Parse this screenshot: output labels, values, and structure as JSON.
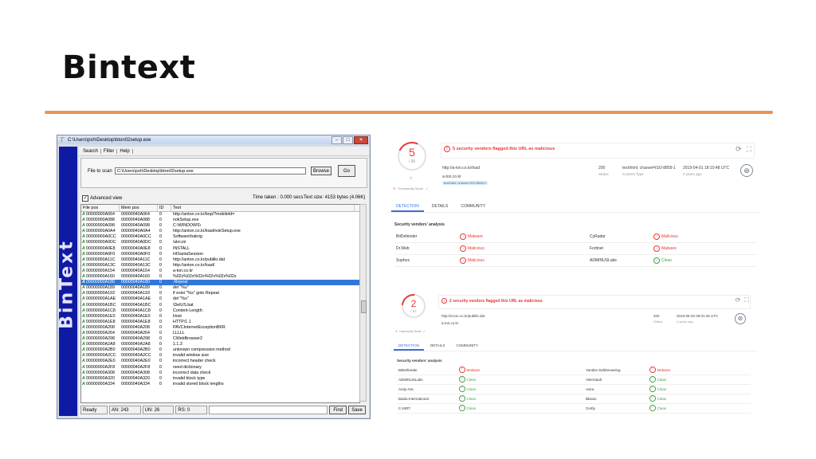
{
  "slide": {
    "title": "Bintext"
  },
  "bintext": {
    "window_title": "C:\\Users\\psh\\Desktop\\bton02setup.exe",
    "sidebar_text": "BinText",
    "menu": [
      "Search",
      "Filter",
      "Help"
    ],
    "file_label": "File to scan",
    "file_path": "C:\\Users\\psh\\Desktop\\bton02setup.exe",
    "browse_label": "Browse",
    "go_label": "Go",
    "advanced_view_label": "Advanced view",
    "time_taken": "Time taken : 0.000 secs",
    "text_size": "Text size: 4153 bytes (4.06K)",
    "columns": [
      "File pos",
      "Mem pos",
      "ID",
      "Text"
    ],
    "rows": [
      {
        "flag": "A",
        "file": "00000000A064",
        "mem": "00000040A064",
        "id": "0",
        "text": "http://anton.co.kr/bop/?mobileId="
      },
      {
        "flag": "A",
        "file": "00000000A088",
        "mem": "00000040A088",
        "id": "0",
        "text": "nokSetup.exe"
      },
      {
        "flag": "A",
        "file": "00000000A098",
        "mem": "00000040A098",
        "id": "0",
        "text": "C:\\WINDOWS\\"
      },
      {
        "flag": "A",
        "file": "00000000A0A4",
        "mem": "00000040A0A4",
        "id": "0",
        "text": "http://anton.co.kr/load/nokSetup.exe"
      },
      {
        "flag": "A",
        "file": "00000000A0CC",
        "mem": "00000040A0CC",
        "id": "0",
        "text": "Software\\hakrig"
      },
      {
        "flag": "A",
        "file": "00000000A0DC",
        "mem": "00000040A0DC",
        "id": "0",
        "text": "\\skn.ini"
      },
      {
        "flag": "A",
        "file": "00000000A0E8",
        "mem": "00000040A0E8",
        "id": "0",
        "text": "INSTALL"
      },
      {
        "flag": "A",
        "file": "00000000A0F0",
        "mem": "00000040A0F0",
        "id": "0",
        "text": "HISantaSession"
      },
      {
        "flag": "A",
        "file": "00000000A11C",
        "mem": "00000040A11C",
        "id": "0",
        "text": "http://anton.co.kr/publikr.dat"
      },
      {
        "flag": "A",
        "file": "00000000A13C",
        "mem": "00000040A13C",
        "id": "0",
        "text": "http://anton.co.kr/load/"
      },
      {
        "flag": "A",
        "file": "00000000A154",
        "mem": "00000040A154",
        "id": "0",
        "text": "a-ton.co.kr"
      },
      {
        "flag": "A",
        "file": "00000000A160",
        "mem": "00000040A160",
        "id": "0",
        "text": "%02x%02x%02x%02x%02x%02x"
      },
      {
        "flag": "A",
        "file": "00000000A180",
        "mem": "00000040A180",
        "id": "0",
        "text": ":Repeat",
        "selected": true
      },
      {
        "flag": "A",
        "file": "00000000A189",
        "mem": "00000040A189",
        "id": "0",
        "text": "del \"%s\""
      },
      {
        "flag": "A",
        "file": "00000000A193",
        "mem": "00000040A193",
        "id": "0",
        "text": "if exist \"%s\" goto Repeat"
      },
      {
        "flag": "A",
        "file": "00000000A1AE",
        "mem": "00000040A1AE",
        "id": "0",
        "text": "del \"%s\""
      },
      {
        "flag": "A",
        "file": "00000000A1BC",
        "mem": "00000040A1BC",
        "id": "0",
        "text": "\\DelUS.bat"
      },
      {
        "flag": "A",
        "file": "00000000A1C8",
        "mem": "00000040A1C8",
        "id": "0",
        "text": "Content-Length:"
      },
      {
        "flag": "A",
        "file": "00000000A1E0",
        "mem": "00000040A1E0",
        "id": "0",
        "text": "Host"
      },
      {
        "flag": "A",
        "file": "00000000A1E8",
        "mem": "00000040A1E8",
        "id": "0",
        "text": "HTTP/1.1"
      },
      {
        "flag": "A",
        "file": "00000000A208",
        "mem": "00000040A208",
        "id": "0",
        "text": "PAVCInternetExceptionBKR"
      },
      {
        "flag": "A",
        "file": "00000000A264",
        "mem": "00000040A264",
        "id": "0",
        "text": "LLLLL"
      },
      {
        "flag": "A",
        "file": "00000000A298",
        "mem": "00000040A298",
        "id": "0",
        "text": "CWebBrowser2"
      },
      {
        "flag": "A",
        "file": "00000000A2A8",
        "mem": "00000040A2A8",
        "id": "0",
        "text": "1.1.3"
      },
      {
        "flag": "A",
        "file": "00000000A2B0",
        "mem": "00000040A2B0",
        "id": "0",
        "text": "unknown compression method"
      },
      {
        "flag": "A",
        "file": "00000000A2CC",
        "mem": "00000040A2CC",
        "id": "0",
        "text": "invalid window size"
      },
      {
        "flag": "A",
        "file": "00000000A2E0",
        "mem": "00000040A2E0",
        "id": "0",
        "text": "incorrect header check"
      },
      {
        "flag": "A",
        "file": "00000000A2F8",
        "mem": "00000040A2F8",
        "id": "0",
        "text": "need dictionary"
      },
      {
        "flag": "A",
        "file": "00000000A308",
        "mem": "00000040A308",
        "id": "0",
        "text": "incorrect data check"
      },
      {
        "flag": "A",
        "file": "00000000A320",
        "mem": "00000040A320",
        "id": "0",
        "text": "invalid block type"
      },
      {
        "flag": "A",
        "file": "00000000A334",
        "mem": "00000040A334",
        "id": "0",
        "text": "invalid stored block lengths"
      }
    ],
    "status": {
      "ready": "Ready",
      "an": "AN: 243",
      "un": "UN: 26",
      "rs": "RS: 0",
      "find_label": "Find",
      "save_label": "Save"
    }
  },
  "vt1": {
    "score": "5",
    "score_total": "/ 66",
    "alert": "5 security vendors flagged this URL as malicious",
    "url": "http://a-ton.co.kr/load",
    "host": "a-ton.co.kr",
    "tag": "text/html; charset=ISO-8859-1",
    "status_code": "200",
    "status_label": "Status",
    "content_type": "text/html; charset=ISO-8859-1",
    "content_type_label": "Content Type",
    "date": "2019-04-01 18:10:48 UTC",
    "ago": "2 years ago",
    "community_label": "Community Score",
    "community_value": "?",
    "tabs": [
      "DETECTION",
      "DETAILS",
      "COMMUNITY"
    ],
    "section": "Security vendors' analysis",
    "rows": [
      {
        "v1": "BitDefender",
        "r1": "Malware",
        "s1": "mal",
        "v2": "CyRadar",
        "r2": "Malicious",
        "s2": "mal"
      },
      {
        "v1": "Dr.Web",
        "r1": "Malicious",
        "s1": "mal",
        "v2": "Fortinet",
        "r2": "Malware",
        "s2": "mal"
      },
      {
        "v1": "Sophos",
        "r1": "Malicious",
        "s1": "mal",
        "v2": "ADMINUSLabs",
        "r2": "Clean",
        "s2": "clean"
      }
    ]
  },
  "vt2": {
    "score": "2",
    "score_total": "/ 67",
    "alert": "2 security vendors flagged this URL as malicious",
    "url": "http://a-ton.co.kr/publikr.dat",
    "host": "a-ton.co.kr",
    "status_code": "200",
    "status_label": "Status",
    "date": "2016-06-20 06:01:45 UTC",
    "ago": "4 years ago",
    "community_label": "Community Score",
    "tabs": [
      "DETECTION",
      "DETAILS",
      "COMMUNITY"
    ],
    "section": "Security vendors' analysis",
    "rows": [
      {
        "v1": "BitDefender",
        "r1": "Malware",
        "s1": "mal",
        "v2": "Yandex Safebrowsing",
        "r2": "Malware",
        "s2": "mal"
      },
      {
        "v1": "ADMINUSLabs",
        "r1": "Clean",
        "s1": "clean",
        "v2": "AlienVault",
        "r2": "Clean",
        "s2": "clean"
      },
      {
        "v1": "Antiy-AVL",
        "r1": "Clean",
        "s1": "clean",
        "v2": "Avira",
        "r2": "Clean",
        "s2": "clean"
      },
      {
        "v1": "Baidu-International",
        "r1": "Clean",
        "s1": "clean",
        "v2": "Bkavio",
        "r2": "Clean",
        "s2": "clean"
      },
      {
        "v1": "C-SIRT",
        "r1": "Clean",
        "s1": "clean",
        "v2": "Certly",
        "r2": "Clean",
        "s2": "clean"
      }
    ]
  },
  "colors": {
    "accent_rule": "#e99555",
    "malicious": "#e53935",
    "clean": "#43a047",
    "bintext_sidebar": "#0e1aa4",
    "selection": "#3276d8",
    "vt_tab_active": "#3b6fd6"
  },
  "icons": [
    "refresh-icon",
    "fullscreen-icon",
    "globe-icon",
    "alert-icon",
    "check-icon",
    "app-icon"
  ]
}
